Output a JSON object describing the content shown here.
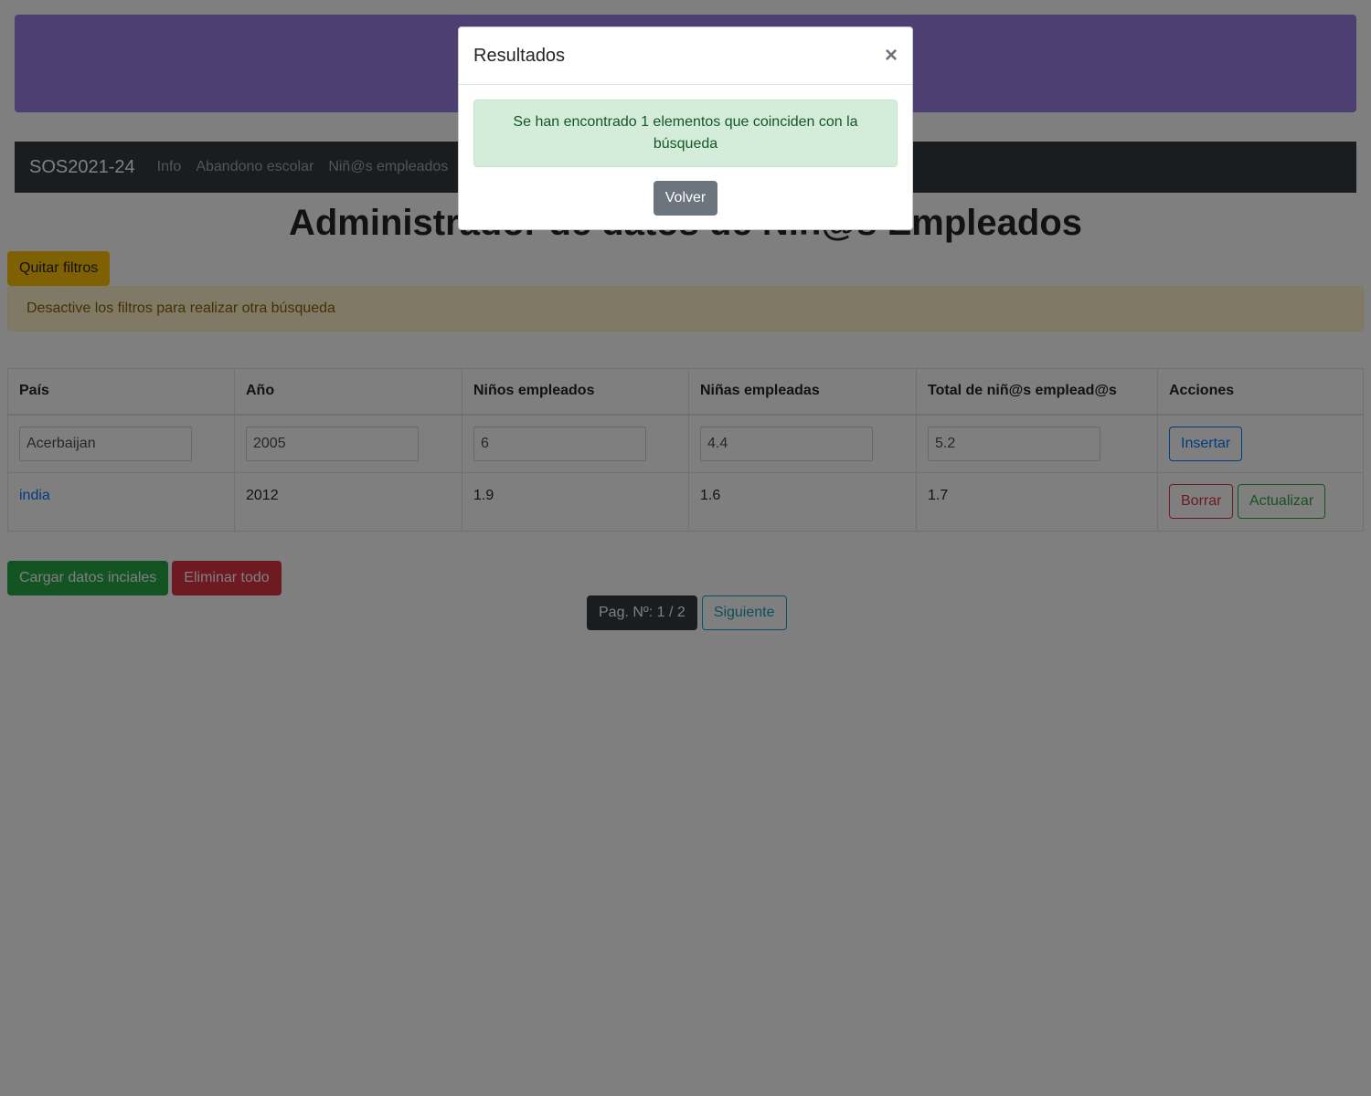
{
  "navbar": {
    "brand": "SOS2021-24",
    "links": [
      "Info",
      "Abandono escolar",
      "Niñ@s empleados"
    ]
  },
  "page_title": "Administrador de datos de Niñ@s Empleados",
  "filters": {
    "quit_label": "Quitar filtros",
    "warning": "Desactive los filtros para realizar otra búsqueda"
  },
  "table": {
    "headers": [
      "País",
      "Año",
      "Niños empleados",
      "Niñas empleadas",
      "Total de niñ@s emplead@s",
      "Acciones"
    ],
    "inputs": {
      "country": "Acerbaijan",
      "year": "2005",
      "boys": "6",
      "girls": "4.4",
      "total": "5.2",
      "insert_label": "Insertar"
    },
    "rows": [
      {
        "country": "india",
        "year": "2012",
        "boys": "1.9",
        "girls": "1.6",
        "total": "1.7"
      }
    ],
    "delete_label": "Borrar",
    "update_label": "Actualizar"
  },
  "actions": {
    "load_label": "Cargar datos inciales",
    "delete_all_label": "Eliminar todo"
  },
  "pagination": {
    "page_label": "Pag. Nº: 1 / 2",
    "next_label": "Siguiente"
  },
  "modal": {
    "title": "Resultados",
    "close": "×",
    "message": "Se han encontrado 1 elementos que coinciden con la búsqueda",
    "back_label": "Volver"
  },
  "colors": {
    "banner": "#9d7ee6",
    "navbar": "#343a40",
    "success": "#28a745",
    "danger": "#dc3545",
    "warning": "#ffc107",
    "primary": "#007bff"
  }
}
